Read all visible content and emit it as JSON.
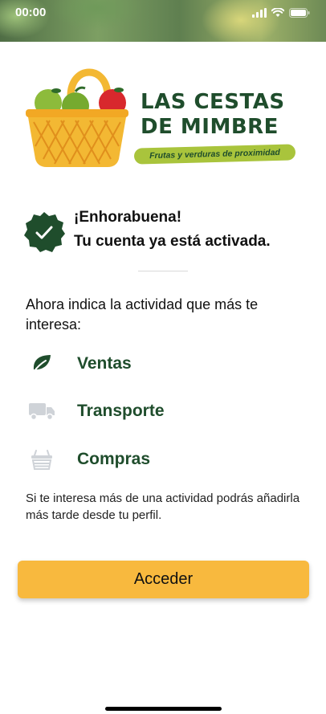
{
  "status_bar": {
    "time": "00:00"
  },
  "brand": {
    "title_line1": "LAS CESTAS",
    "title_line2": "DE MIMBRE",
    "tagline": "Frutas y verduras de proximidad"
  },
  "congrats": {
    "line1": "¡Enhorabuena!",
    "line2": "Tu cuenta ya está activada."
  },
  "prompt": "Ahora indica la actividad que más te interesa:",
  "activities": [
    {
      "label": "Ventas",
      "icon": "leaf-icon",
      "color": "#1f4d2c"
    },
    {
      "label": "Transporte",
      "icon": "truck-icon",
      "color": "#cfd3d8"
    },
    {
      "label": "Compras",
      "icon": "basket-icon",
      "color": "#cfd3d8"
    }
  ],
  "note": "Si te interesa más de una actividad podrás añadirla más tarde desde tu perfil.",
  "cta": {
    "label": "Acceder"
  },
  "colors": {
    "brand_green": "#1f4d2c",
    "accent_yellow": "#f8b93e",
    "tagline_green": "#a9c43c"
  }
}
